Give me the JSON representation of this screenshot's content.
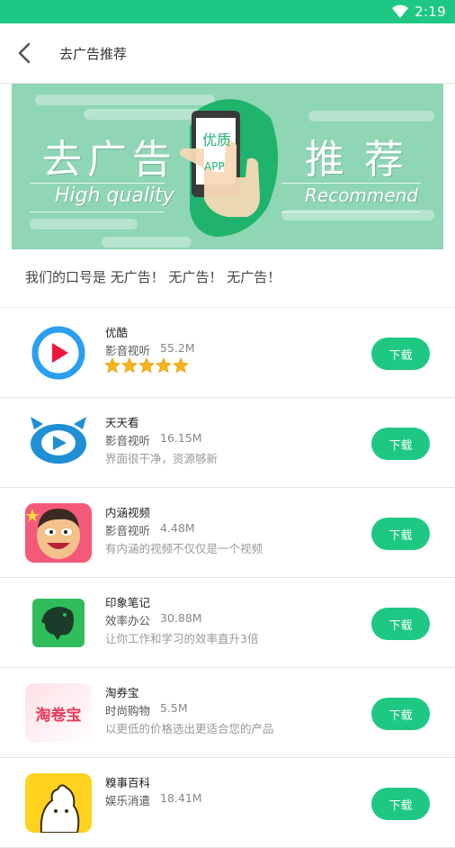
{
  "status_bar": {
    "time": "2:19"
  },
  "header": {
    "title": "去广告推荐"
  },
  "banner": {
    "title_left": "去广告",
    "title_right": "推荐",
    "subtitle_left": "High quality",
    "subtitle_right": "Recommend",
    "phone_text_1": "优质",
    "phone_text_2": "APP",
    "bg_color": "#8fd6b4"
  },
  "slogan": "我们的口号是 无广告！ 无广告！ 无广告！",
  "apps": [
    {
      "name": "优酷",
      "category": "影音视听",
      "size": "55.2M",
      "desc": "",
      "rating": 5,
      "button": "下载"
    },
    {
      "name": "天天看",
      "category": "影音视听",
      "size": "16.15M",
      "desc": "界面很干净，资源够新",
      "button": "下载"
    },
    {
      "name": "内涵视频",
      "category": "影音视听",
      "size": "4.48M",
      "desc": "有内涵的视频不仅仅是一个视频",
      "button": "下载"
    },
    {
      "name": "印象笔记",
      "category": "效率办公",
      "size": "30.88M",
      "desc": "让你工作和学习的效率直升3倍",
      "button": "下载"
    },
    {
      "name": "淘券宝",
      "category": "时尚购物",
      "size": "5.5M",
      "desc": "以更低的价格选出更适合您的产品",
      "button": "下载",
      "icon_text": "淘卷宝"
    },
    {
      "name": "糗事百科",
      "category": "娱乐消遣",
      "size": "18.41M",
      "desc": "",
      "button": "下载"
    }
  ],
  "colors": {
    "accent": "#1ec883",
    "star": "#f5b51b"
  }
}
